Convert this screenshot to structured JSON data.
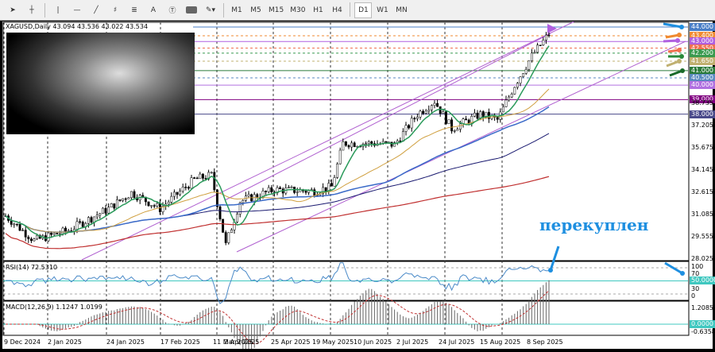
{
  "toolbar": {
    "tools": [
      "cursor",
      "crosshair",
      "vertical-line",
      "horizontal-line",
      "trend-line",
      "fibonacci",
      "gann",
      "text",
      "text-label",
      "rectangle",
      "shapes"
    ],
    "text_tool": "A",
    "timeframes": [
      "M1",
      "M5",
      "M15",
      "M30",
      "H1",
      "H4",
      "D1",
      "W1",
      "MN"
    ],
    "active_timeframe": "D1"
  },
  "chart_header": "XAGUSD,Daily  43.094 43.536 43.022 43.534",
  "annotation": "перекуплен",
  "price_labels": [
    {
      "v": "44.000",
      "p": 44.0,
      "c": "#4a7fc7"
    },
    {
      "v": "43.400",
      "p": 43.4,
      "c": "#f08a30"
    },
    {
      "v": "43.000",
      "p": 43.0,
      "c": "#b060e0"
    },
    {
      "v": "42.550",
      "p": 42.55,
      "c": "#f07050"
    },
    {
      "v": "42.200",
      "p": 42.2,
      "c": "#3a9a50"
    },
    {
      "v": "41.650",
      "p": 41.65,
      "c": "#c0b070"
    },
    {
      "v": "41.000",
      "p": 41.0,
      "c": "#2a7a3a"
    },
    {
      "v": "40.500",
      "p": 40.5,
      "c": "#5a8ac0"
    },
    {
      "v": "40.000",
      "p": 40.0,
      "c": "#b070e0"
    },
    {
      "v": "39.000",
      "p": 39.0,
      "c": "#800080"
    },
    {
      "v": "38.735",
      "p": 38.735,
      "c": ""
    },
    {
      "v": "38.000",
      "p": 38.0,
      "c": "#4a4a8a"
    },
    {
      "v": "37.205",
      "p": 37.205,
      "c": ""
    },
    {
      "v": "35.675",
      "p": 35.675,
      "c": ""
    },
    {
      "v": "34.145",
      "p": 34.145,
      "c": ""
    },
    {
      "v": "32.615",
      "p": 32.615,
      "c": ""
    },
    {
      "v": "31.085",
      "p": 31.085,
      "c": ""
    },
    {
      "v": "29.555",
      "p": 29.555,
      "c": ""
    },
    {
      "v": "28.025",
      "p": 28.025,
      "c": ""
    }
  ],
  "rsi": {
    "title": "RSI(14) 72.5310",
    "levels": [
      "100",
      "70",
      "50.0000",
      "30",
      "0"
    ]
  },
  "macd": {
    "title": "MACD(12,26,9) 1.1247 1.0199",
    "levels": [
      "1.2085",
      "0.0000",
      "-0.6358"
    ]
  },
  "dates": [
    "9 Dec 2024",
    "2 Jan 2025",
    "24 Jan 2025",
    "17 Feb 2025",
    "11 Mar 2025",
    "2 Apr 2025",
    "25 Apr 2025",
    "19 May 2025",
    "10 Jun 2025",
    "2 Jul 2025",
    "24 Jul 2025",
    "15 Aug 2025",
    "8 Sep 2025"
  ],
  "chart_data": {
    "type": "candlestick",
    "symbol": "XAGUSD",
    "timeframe": "Daily",
    "ylim": [
      28.025,
      44.0
    ],
    "price_path": [
      [
        0,
        31
      ],
      [
        10,
        29.3
      ],
      [
        22,
        30
      ],
      [
        36,
        31.5
      ],
      [
        44,
        32.6
      ],
      [
        54,
        31.5
      ],
      [
        66,
        33.5
      ],
      [
        72,
        33.8
      ],
      [
        77,
        29
      ],
      [
        82,
        32
      ],
      [
        94,
        32.8
      ],
      [
        108,
        32.7
      ],
      [
        114,
        33
      ],
      [
        118,
        36
      ],
      [
        128,
        36
      ],
      [
        136,
        35.9
      ],
      [
        144,
        38
      ],
      [
        150,
        38.9
      ],
      [
        156,
        37
      ],
      [
        166,
        38
      ],
      [
        172,
        37.6
      ],
      [
        178,
        40
      ],
      [
        184,
        42
      ],
      [
        190,
        43.53
      ]
    ]
  }
}
